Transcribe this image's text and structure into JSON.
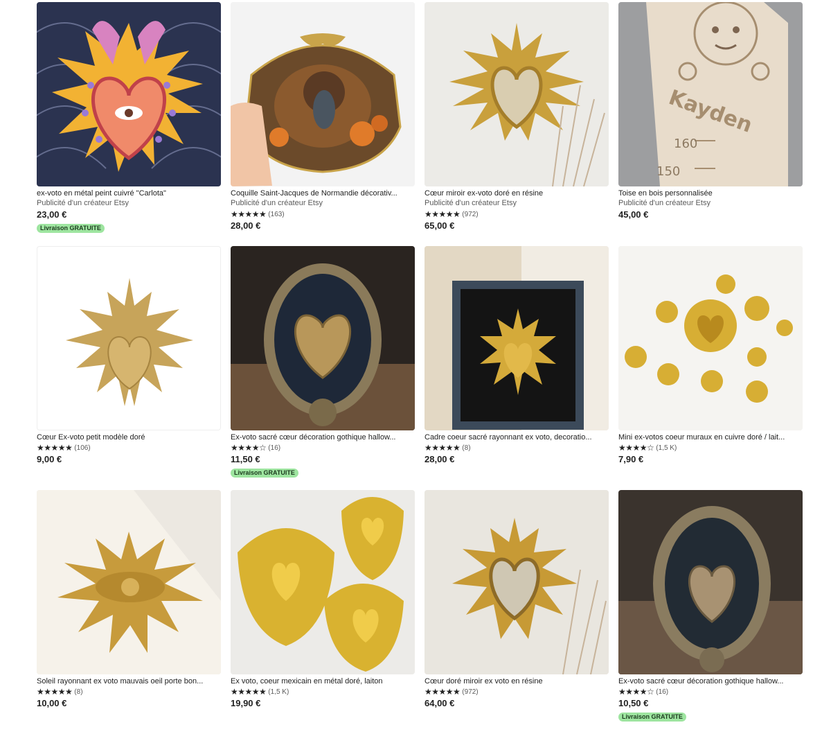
{
  "colors": {
    "badge_bg": "#9ee5a0",
    "text": "#222222",
    "muted": "#595959"
  },
  "star_icon": "★",
  "listings": [
    {
      "title": "ex-voto en métal peint cuivré \"Carlota\"",
      "sub": "Publicité d'un créateur Etsy",
      "stars": "",
      "count": "",
      "price": "23,00 €",
      "badge": "Livraison GRATUITE"
    },
    {
      "title": "Coquille Saint-Jacques de Normandie décorativ...",
      "sub": "Publicité d'un créateur Etsy",
      "stars": "★★★★★",
      "count": "(163)",
      "price": "28,00 €",
      "badge": ""
    },
    {
      "title": "Cœur miroir ex-voto doré en résine",
      "sub": "Publicité d'un créateur Etsy",
      "stars": "★★★★★",
      "count": "(972)",
      "price": "65,00 €",
      "badge": ""
    },
    {
      "title": "Toise en bois personnalisée",
      "sub": "Publicité d'un créateur Etsy",
      "stars": "",
      "count": "",
      "price": "45,00 €",
      "badge": ""
    },
    {
      "title": "Cœur Ex-voto petit modèle doré",
      "sub": "",
      "stars": "★★★★★",
      "count": "(106)",
      "price": "9,00 €",
      "badge": ""
    },
    {
      "title": "Ex-voto sacré cœur décoration gothique hallow...",
      "sub": "",
      "stars": "★★★★☆",
      "count": "(16)",
      "price": "11,50 €",
      "badge": "Livraison GRATUITE"
    },
    {
      "title": "Cadre coeur sacré rayonnant ex voto, decoratio...",
      "sub": "",
      "stars": "★★★★★",
      "count": "(8)",
      "price": "28,00 €",
      "badge": ""
    },
    {
      "title": "Mini ex-votos coeur muraux en cuivre doré / lait...",
      "sub": "",
      "stars": "★★★★☆",
      "count": "(1,5 K)",
      "price": "7,90 €",
      "badge": ""
    },
    {
      "title": "Soleil rayonnant ex voto mauvais oeil porte bon...",
      "sub": "",
      "stars": "★★★★★",
      "count": "(8)",
      "price": "10,00 €",
      "badge": ""
    },
    {
      "title": "Ex voto, coeur mexicain en métal doré, laiton",
      "sub": "",
      "stars": "★★★★★",
      "count": "(1,5 K)",
      "price": "19,90 €",
      "badge": ""
    },
    {
      "title": "Cœur doré miroir ex voto en résine",
      "sub": "",
      "stars": "★★★★★",
      "count": "(972)",
      "price": "64,00 €",
      "badge": ""
    },
    {
      "title": "Ex-voto sacré cœur décoration gothique hallow...",
      "sub": "",
      "stars": "★★★★☆",
      "count": "(16)",
      "price": "10,50 €",
      "badge": "Livraison GRATUITE"
    }
  ]
}
